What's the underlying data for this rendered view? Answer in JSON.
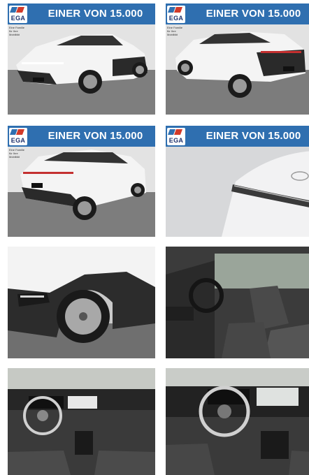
{
  "gallery": {
    "banner_text": "EINER VON 15.000",
    "logo_text": "EGA",
    "logo_tagline": "Eine Familie für Ihre Mobilität",
    "colors": {
      "banner": "#2f6fb0",
      "car_body": "#f2f2f2",
      "cladding": "#2b2b2b",
      "background": "#d9d9d9",
      "interior": "#3a3a3a"
    },
    "photos": [
      {
        "subject": "front-three-quarter",
        "banner": true
      },
      {
        "subject": "rear-three-quarter",
        "banner": true
      },
      {
        "subject": "rear-three-quarter-right",
        "banner": true
      },
      {
        "subject": "front-light-bar-closeup",
        "banner": true
      },
      {
        "subject": "front-wheel-closeup",
        "banner": false
      },
      {
        "subject": "front-seats-interior",
        "banner": false
      },
      {
        "subject": "dashboard-view",
        "banner": false
      },
      {
        "subject": "cockpit-closeup",
        "banner": false
      }
    ]
  }
}
